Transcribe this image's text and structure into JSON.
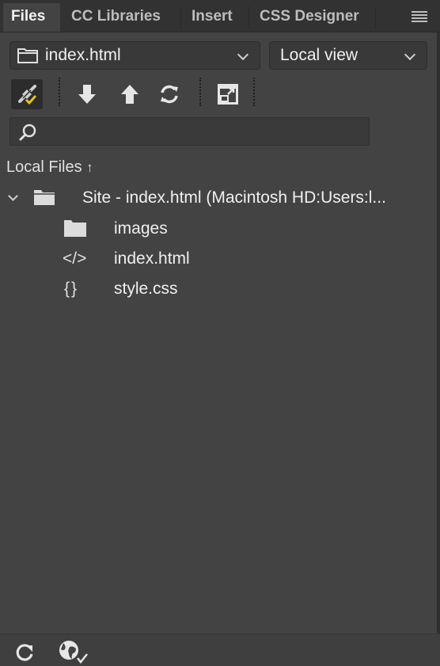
{
  "tabs": [
    {
      "label": "Files",
      "active": true
    },
    {
      "label": "CC Libraries",
      "active": false
    },
    {
      "label": "Insert",
      "active": false
    },
    {
      "label": "CSS Designer",
      "active": false
    }
  ],
  "site_select": {
    "value": "index.html",
    "icon": "folder-icon"
  },
  "view_select": {
    "value": "Local view"
  },
  "toolbar": [
    {
      "name": "connect-button",
      "icon": "plug-check-icon",
      "active": true
    },
    {
      "name": "get-files-button",
      "icon": "arrow-down-icon"
    },
    {
      "name": "put-files-button",
      "icon": "arrow-up-icon"
    },
    {
      "name": "synchronize-button",
      "icon": "sync-icon"
    },
    {
      "name": "expand-button",
      "icon": "expand-window-icon"
    }
  ],
  "search": {
    "placeholder": "",
    "value": ""
  },
  "section": {
    "title": "Local Files",
    "sort_icon": "↑"
  },
  "tree": {
    "root": {
      "label": "Site - index.html (Macintosh HD:Users:l...",
      "expanded": true
    },
    "children": [
      {
        "label": "images",
        "icon": "folder-icon"
      },
      {
        "label": "index.html",
        "icon": "html-code-icon"
      },
      {
        "label": "style.css",
        "icon": "css-braces-icon"
      }
    ]
  },
  "footer": {
    "buttons": [
      {
        "name": "refresh-button",
        "icon": "refresh-icon"
      },
      {
        "name": "site-check-button",
        "icon": "globe-check-icon"
      }
    ]
  },
  "colors": {
    "accent_check": "#e8c21a",
    "panel_bg": "#434343",
    "tabbar_bg": "#323232"
  }
}
